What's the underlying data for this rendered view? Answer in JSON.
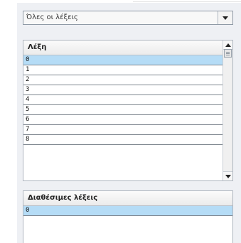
{
  "filter": {
    "selected": "Όλες οι λέξεις",
    "icon": "chevron-down-icon"
  },
  "words_table": {
    "header": "Λέξη",
    "rows": [
      "0",
      "1",
      "2",
      "3",
      "4",
      "5",
      "6",
      "7",
      "8"
    ],
    "selected_index": 0
  },
  "available_table": {
    "header": "Διαθέσιμες λέξεις",
    "rows": [
      "0"
    ],
    "selected_index": 0
  },
  "colors": {
    "selection": "#b5dcf6",
    "panel": "#eef0f4"
  }
}
